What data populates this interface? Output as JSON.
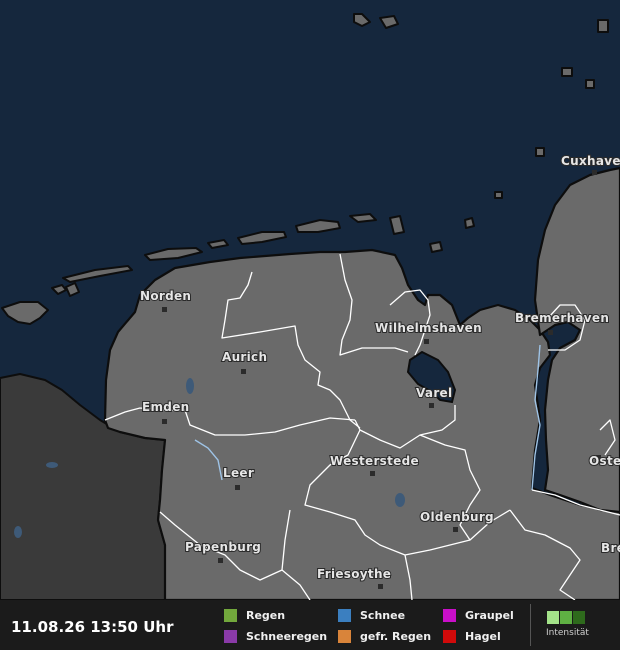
{
  "map": {
    "cities": [
      {
        "name": "Cuxhaven"
      },
      {
        "name": "Norden"
      },
      {
        "name": "Wilhelmshaven"
      },
      {
        "name": "Bremerhaven"
      },
      {
        "name": "Aurich"
      },
      {
        "name": "Varel"
      },
      {
        "name": "Emden"
      },
      {
        "name": "Leer"
      },
      {
        "name": "Westerstede"
      },
      {
        "name": "Oste Schar"
      },
      {
        "name": "Oldenburg"
      },
      {
        "name": "Papenburg"
      },
      {
        "name": "Bre"
      },
      {
        "name": "Friesoythe"
      }
    ],
    "colors": {
      "sea": "#15273d",
      "land": "#6a6a6a",
      "outside_region": "#3a3a3a",
      "border": "#ffffff"
    }
  },
  "footer": {
    "timestamp": "11.08.26 13:50 Uhr",
    "legend": [
      {
        "label": "Regen",
        "color": "#72a83c"
      },
      {
        "label": "Schnee",
        "color": "#3b7fc0"
      },
      {
        "label": "Graupel",
        "color": "#c90fc9"
      },
      {
        "label": "Schneeregen",
        "color": "#8a3aa8"
      },
      {
        "label": "gefr. Regen",
        "color": "#d9843a"
      },
      {
        "label": "Hagel",
        "color": "#d10a0a"
      }
    ],
    "intensity": {
      "label": "Intensität",
      "levels": [
        "#a4e38a",
        "#5fb043",
        "#2e6a1c"
      ]
    }
  }
}
